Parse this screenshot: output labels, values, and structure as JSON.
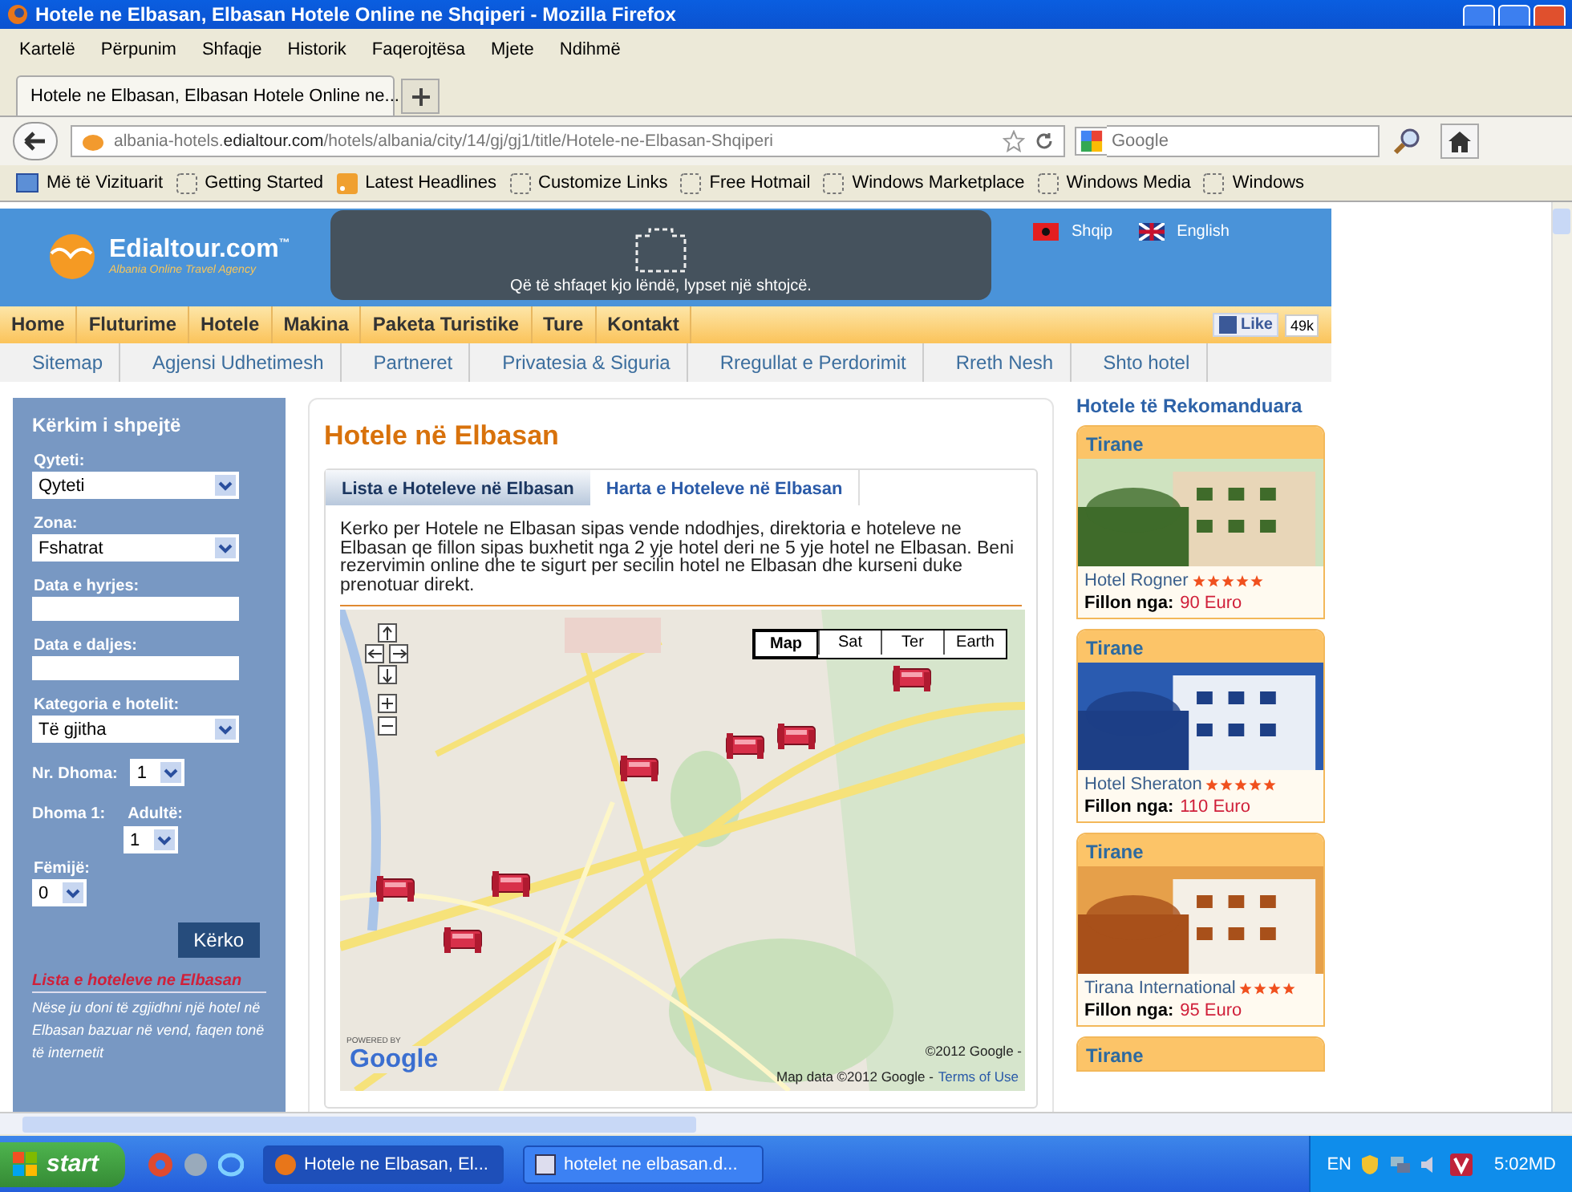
{
  "window": {
    "title": "Hotele ne Elbasan, Elbasan Hotele Online ne Shqiperi - Mozilla Firefox"
  },
  "menu_bar": [
    "Kartelë",
    "Përpunim",
    "Shfaqje",
    "Historik",
    "Faqerojtësa",
    "Mjete",
    "Ndihmë"
  ],
  "browser_tab": {
    "title": "Hotele ne Elbasan, Elbasan Hotele Online ne..."
  },
  "address_bar": {
    "subdomain": "albania-hotels.",
    "domain": "edialtour.com",
    "path": "/hotels/albania/city/14/gj/gj1/title/Hotele-ne-Elbasan-Shqiperi"
  },
  "search_field": {
    "placeholder": "Google"
  },
  "bookmarks": [
    "Më të Vizituarit",
    "Getting Started",
    "Latest Headlines",
    "Customize Links",
    "Free Hotmail",
    "Windows Marketplace",
    "Windows Media",
    "Windows"
  ],
  "site_header": {
    "logo": "Edialtour.com",
    "logo_mark": "™",
    "tagline": "Albania Online Travel Agency",
    "plugin_notice": "Që të shfaqet kjo lëndë, lypset një shtojcë.",
    "languages": [
      "Shqip",
      "English"
    ]
  },
  "main_nav": [
    "Home",
    "Fluturime",
    "Hotele",
    "Makina",
    "Paketa Turistike",
    "Ture",
    "Kontakt"
  ],
  "like": {
    "label": "Like",
    "count": "49k"
  },
  "sub_nav": [
    "Sitemap",
    "Agjensi Udhetimesh",
    "Partneret",
    "Privatesia & Siguria",
    "Rregullat e Perdorimit",
    "Rreth Nesh",
    "Shto hotel"
  ],
  "search_panel": {
    "title": "Kërkim i shpejtë",
    "fields": [
      {
        "kind": "select",
        "label": "Qyteti:",
        "value": "Qyteti"
      },
      {
        "kind": "select",
        "label": "Zona:",
        "value": "Fshatrat"
      },
      {
        "kind": "text",
        "label": "Data e hyrjes:"
      },
      {
        "kind": "text",
        "label": "Data e daljes:"
      },
      {
        "kind": "select",
        "label": "Kategoria e hotelit:",
        "value": "Të gjitha"
      }
    ],
    "rooms": {
      "label": "Nr. Dhoma:",
      "value": "1"
    },
    "room": {
      "label": "Dhoma 1:",
      "adults_label": "Adultë:",
      "adults": "1",
      "children_label": "Fëmijë:",
      "children": "0"
    },
    "button": "Kërko",
    "list_title": "Lista e hoteleve ne Elbasan",
    "list_text": "Nëse ju doni të zgjidhni një hotel në Elbasan bazuar në vend, faqen tonë të internetit"
  },
  "content": {
    "title": "Hotele në Elbasan",
    "tabs": [
      {
        "label": "Lista e Hoteleve në Elbasan",
        "selected": false
      },
      {
        "label": "Harta e Hoteleve në Elbasan",
        "selected": true
      }
    ],
    "description": "Kerko per Hotele ne Elbasan sipas vende ndodhjes, direktoria e hoteleve ne Elbasan qe fillon sipas buxhetit nga 2 yje hotel deri ne 5 yje hotel ne Elbasan. Beni rezervimin online dhe te sigurt per secilin hotel ne Elbasan dhe kurseni duke prenotuar direkt.",
    "map": {
      "kind": "picture",
      "map_types": [
        {
          "label": "Map",
          "selected": true
        },
        {
          "label": "Sat",
          "selected": false
        },
        {
          "label": "Ter",
          "selected": false
        },
        {
          "label": "Earth",
          "selected": false
        }
      ],
      "powered_by": "POWERED BY",
      "logo": "Google",
      "copyright": "©2012 Google -",
      "map_data": "Map data ©2012 Google -",
      "terms_link": "Terms of Use"
    }
  },
  "recommended": {
    "title": "Hotele të Rekomanduara",
    "hotels": [
      {
        "city": "Tirane",
        "name": "Hotel Rogner",
        "stars": 5,
        "price_label": "Fillon nga:",
        "price": "90 Euro"
      },
      {
        "city": "Tirane",
        "name": "Hotel Sheraton",
        "stars": 5,
        "price_label": "Fillon nga:",
        "price": "110 Euro"
      },
      {
        "city": "Tirane",
        "name": "Tirana International",
        "stars": 4,
        "price_label": "Fillon nga:",
        "price": "95 Euro"
      },
      {
        "city": "Tirane"
      }
    ]
  },
  "taskbar": {
    "start": "start",
    "tasks": [
      {
        "label": "Hotele ne Elbasan, El...",
        "selected": true
      },
      {
        "label": "hotelet ne elbasan.d...",
        "selected": false
      }
    ],
    "language": "EN",
    "clock": "5:02MD"
  }
}
